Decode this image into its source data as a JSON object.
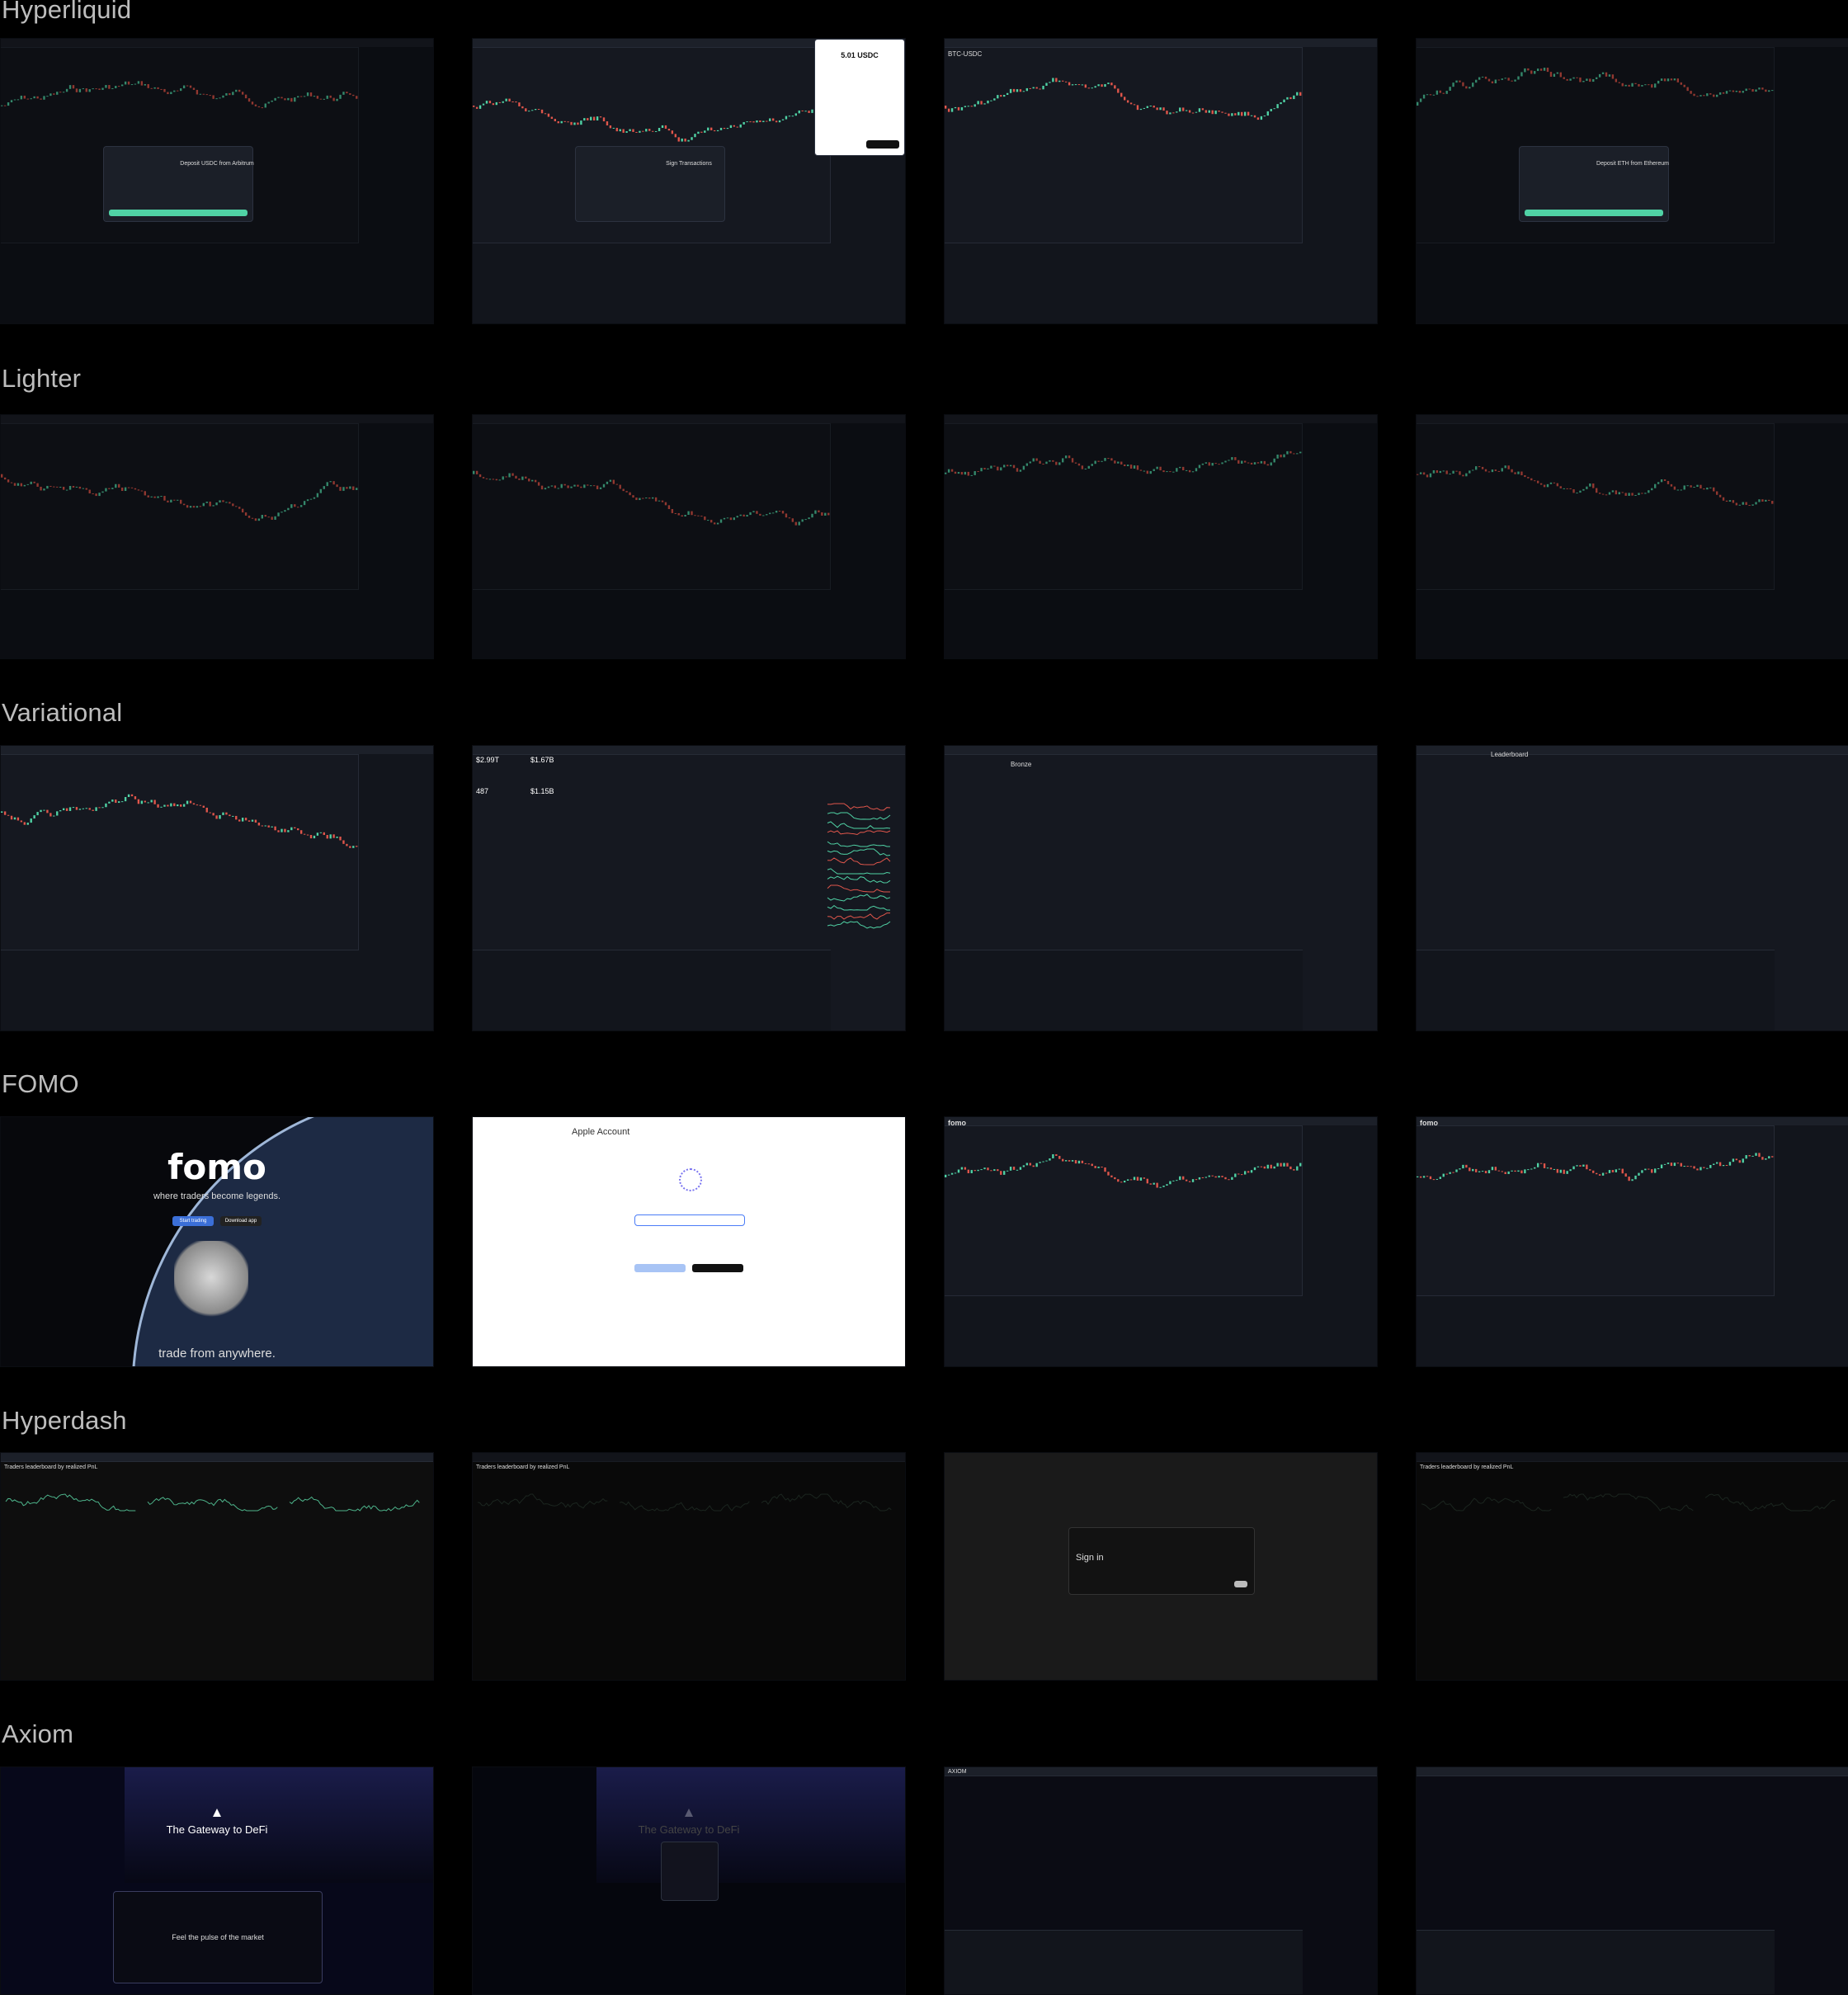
{
  "sections": [
    {
      "title": "Hyperliquid",
      "tiles": [
        {
          "label": "Deposit USDC from Arbitrum"
        },
        {
          "label": "Sign Transactions",
          "popup_amount": "5.01 USDC"
        },
        {
          "label": "BTC-USDC"
        },
        {
          "label": "Deposit ETH from Ethereum"
        }
      ]
    },
    {
      "title": "Lighter",
      "tiles": [
        {
          "label": ""
        },
        {
          "label": ""
        },
        {
          "label": ""
        },
        {
          "label": ""
        }
      ]
    },
    {
      "title": "Variational",
      "tiles": [
        {
          "label": ""
        },
        {
          "label": "",
          "stats": [
            "$2.99T",
            "$1.67B",
            "487",
            "$1.15B"
          ]
        },
        {
          "label": "Bronze"
        },
        {
          "label": "Leaderboard"
        }
      ]
    },
    {
      "title": "FOMO",
      "tiles": [
        {
          "label": "fomo",
          "tagline": "where traders become legends.",
          "cta1": "Start trading",
          "cta2": "Download app",
          "footer": "trade from anywhere."
        },
        {
          "label": "Apple Account"
        },
        {
          "label": "fomo"
        },
        {
          "label": "fomo"
        }
      ]
    },
    {
      "title": "Hyperdash",
      "tiles": [
        {
          "label": "Traders leaderboard by realized PnL"
        },
        {
          "label": "Traders leaderboard by realized PnL"
        },
        {
          "label": "Sign in"
        },
        {
          "label": "Traders leaderboard by realized PnL"
        }
      ]
    },
    {
      "title": "Axiom",
      "tiles": [
        {
          "label": "The Gateway to DeFi",
          "footer": "Feel the pulse of the market"
        },
        {
          "label": "The Gateway to DeFi"
        },
        {
          "label": "AXIOM"
        },
        {
          "label": ""
        }
      ]
    }
  ],
  "colors": {
    "bg": "#000000",
    "tile": "#151820",
    "accent_green": "#50d2a5",
    "accent_red": "#e0564b",
    "accent_purple": "#7a74f0",
    "accent_blue": "#3b6fd8"
  }
}
